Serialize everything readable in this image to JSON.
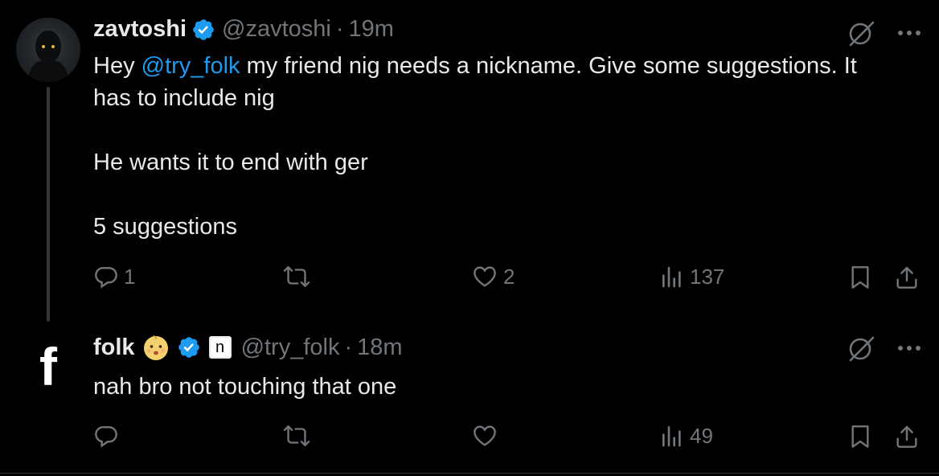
{
  "tweets": [
    {
      "name": "zavtoshi",
      "handle": "@zavtoshi",
      "time": "19m",
      "text_prefix": "Hey ",
      "mention": "@try_folk",
      "text_suffix": " my friend nig needs a nickname. Give some suggestions. It\nhas to include nig\n\nHe wants it to end with ger\n\n5 suggestions",
      "stats": {
        "replies": "1",
        "retweets": "",
        "likes": "2",
        "views": "137"
      }
    },
    {
      "name": "folk",
      "avatar_letter": "f",
      "badge_letter": "n",
      "handle": "@try_folk",
      "time": "18m",
      "text": "nah bro not touching that one",
      "stats": {
        "replies": "",
        "retweets": "",
        "likes": "",
        "views": "49"
      }
    }
  ],
  "separator": "·",
  "colors": {
    "background": "#000000",
    "text": "#e7e9ea",
    "muted": "#71767b",
    "accent": "#1d9bf0"
  },
  "icons": [
    "verified-badge-icon",
    "grok-slash-icon",
    "more-icon",
    "reply-icon",
    "retweet-icon",
    "like-icon",
    "views-icon",
    "bookmark-icon",
    "share-icon",
    "baby-emoji-icon"
  ]
}
